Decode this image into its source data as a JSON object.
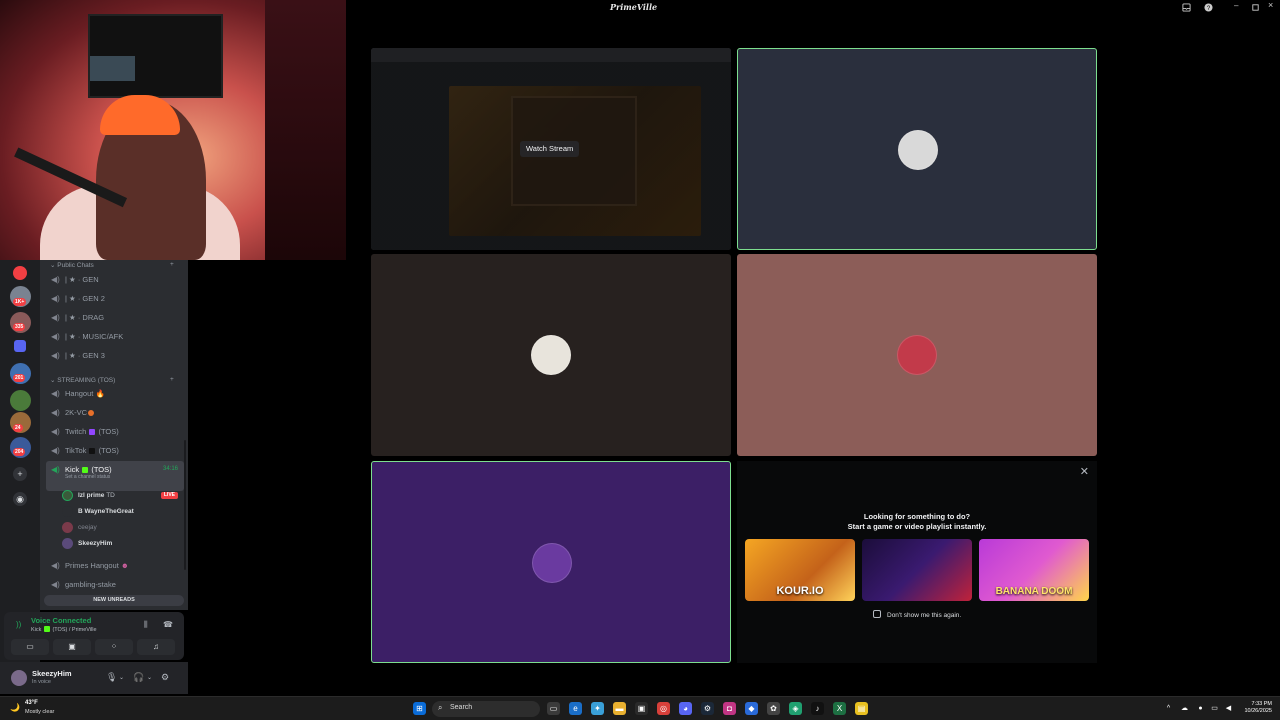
{
  "window": {
    "title": "PrimeVille"
  },
  "sidebar": {
    "categories": [
      {
        "label": "Public Chats"
      },
      {
        "label": "STREAMING (TOS)"
      }
    ],
    "public_channels": [
      {
        "label": "| ★ · GEN"
      },
      {
        "label": "| ★ · GEN 2"
      },
      {
        "label": "| ★ · DRAG"
      },
      {
        "label": "| ★ · MUSIC/AFK"
      },
      {
        "label": "| ★ · GEN 3"
      }
    ],
    "streaming_channels": [
      {
        "label": "Hangout"
      },
      {
        "label": "2K-VC"
      },
      {
        "label": "Twitch",
        "suffix": "(TOS)"
      },
      {
        "label": "TikTok",
        "suffix": "(TOS)"
      }
    ],
    "active_channel": {
      "label": "Kick",
      "suffix": "(TOS)",
      "timer": "34:16",
      "status": "Set a channel status",
      "members": [
        {
          "name": "lzl prime",
          "tag": "TD",
          "live": "LIVE"
        },
        {
          "name": "B WayneTheGreat"
        },
        {
          "name": "ceejay"
        },
        {
          "name": "SkeezyHim"
        }
      ]
    },
    "more_channels": [
      {
        "label": "Primes Hangout"
      },
      {
        "label": "gambling-stake"
      }
    ],
    "new_unreads": "NEW UNREADS",
    "server_badges": [
      "201",
      "1K+",
      "335",
      "24",
      "204"
    ]
  },
  "voice": {
    "status": "Voice Connected",
    "location": "Kick",
    "location_suffix": "(TOS) / PrimeVille"
  },
  "user": {
    "name": "SkeezyHim",
    "status": "In voice"
  },
  "stage": {
    "watch_stream": "Watch Stream"
  },
  "activity": {
    "heading": "Looking for something to do?",
    "subheading": "Start a game or video playlist instantly.",
    "games": [
      "KOUR.IO",
      "",
      "BANANA DOOM"
    ],
    "dont_show": "Don't show me this again."
  },
  "taskbar": {
    "temp": "43°F",
    "weather": "Mostly clear",
    "search": "Search",
    "time": "7:33 PM",
    "date": "10/26/2025"
  },
  "colors": {
    "voice_green": "#23a55a",
    "speaking_border": "#7dde8f",
    "live_red": "#f23f43",
    "tile_purple": "#3c1f66"
  }
}
